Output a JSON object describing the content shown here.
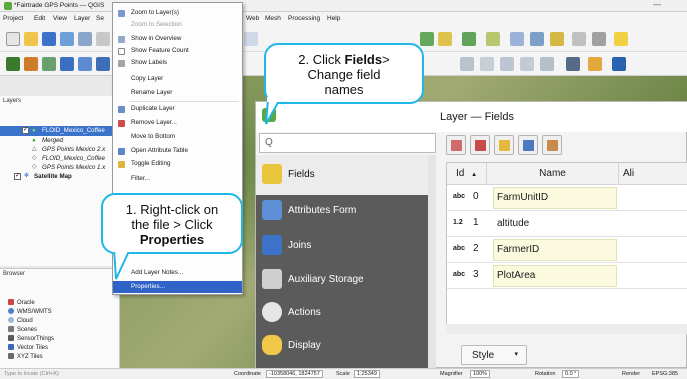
{
  "window": {
    "title": "*Fairtrade GPS Points — QGIS",
    "minimize_glyph": "—"
  },
  "menubar": {
    "items": [
      "Project",
      "Edit",
      "View",
      "Layer",
      "Se",
      "Web",
      "Mesh",
      "Processing",
      "Help"
    ]
  },
  "layers_panel": {
    "title": "Layers",
    "layers": [
      {
        "name": "FLOID_Mexico_Coffee",
        "checked": true,
        "selected": true
      },
      {
        "name": "Merged",
        "checked": true,
        "selected": false
      },
      {
        "name": "GPS Points Mexico 2.x",
        "checked": false,
        "selected": false
      },
      {
        "name": "FLOID_Mexico_Coffee",
        "checked": false,
        "selected": false
      },
      {
        "name": "GPS Points Mexico 1.x",
        "checked": false,
        "selected": false
      },
      {
        "name": "Satellite Map",
        "checked": true,
        "selected": false
      }
    ]
  },
  "browser_panel": {
    "title": "Browser",
    "items": [
      "Oracle",
      "WMS/WMTS",
      "Cloud",
      "Scenes",
      "SensorThings",
      "Vector Tiles",
      "XYZ Tiles"
    ]
  },
  "context_menu": {
    "items": [
      {
        "label": "Zoom to Layer(s)",
        "disabled": false
      },
      {
        "label": "Zoom to Selection",
        "disabled": true
      },
      {
        "label": "Show in Overview",
        "disabled": false
      },
      {
        "label": "Show Feature Count",
        "disabled": false
      },
      {
        "label": "Show Labels",
        "disabled": false
      },
      {
        "label": "Copy Layer",
        "disabled": false
      },
      {
        "label": "Rename Layer",
        "disabled": false
      },
      {
        "label": "Duplicate Layer",
        "disabled": false
      },
      {
        "label": "Remove Layer...",
        "disabled": false
      },
      {
        "label": "Move to Bottom",
        "disabled": false
      },
      {
        "label": "Open Attribute Table",
        "disabled": false
      },
      {
        "label": "Toggle Editing",
        "disabled": false
      },
      {
        "label": "Filter...",
        "disabled": false
      },
      {
        "label": "Add Layer Notes...",
        "disabled": false
      },
      {
        "label": "Properties...",
        "disabled": false,
        "selected": true
      }
    ]
  },
  "dialog": {
    "title": "Layer — Fields",
    "search_placeholder": "",
    "search_glyph": "Q",
    "sidebar": [
      {
        "label": "Fields",
        "icon": "fields-icon",
        "color": "#e8c53a",
        "selected": true
      },
      {
        "label": "Attributes Form",
        "icon": "form-icon",
        "color": "#5d8fd6",
        "selected": false
      },
      {
        "label": "Joins",
        "icon": "joins-icon",
        "color": "#3c73c9",
        "selected": false
      },
      {
        "label": "Auxiliary Storage",
        "icon": "database-icon",
        "color": "#cfcfcf",
        "selected": false
      },
      {
        "label": "Actions",
        "icon": "gear-icon",
        "color": "#e6e6e6",
        "selected": false
      },
      {
        "label": "Display",
        "icon": "speech-bubble-icon",
        "color": "#f2c84a",
        "selected": false
      }
    ],
    "grid": {
      "headers": [
        "Id",
        "Name",
        "Ali"
      ],
      "sort_glyph": "▲",
      "rows": [
        {
          "type": "abc",
          "id": "0",
          "name": "FarmUnitID"
        },
        {
          "type": "1.2",
          "id": "1",
          "name": "altitude"
        },
        {
          "type": "abc",
          "id": "2",
          "name": "FarmerID"
        },
        {
          "type": "abc",
          "id": "3",
          "name": "PlotArea"
        }
      ]
    },
    "style_button": {
      "label": "Style",
      "arrow": "▾"
    }
  },
  "callouts": {
    "step1": {
      "line1": "1. Right-click on",
      "line2": "the file > Click",
      "bold": "Properties"
    },
    "step2": {
      "prefix": "2. Click ",
      "bold": "Fields",
      "suffix": ">",
      "line2": "Change field",
      "line3": "names"
    }
  },
  "statusbar": {
    "locate_placeholder": "Type to locate (Ctrl+K)",
    "coordinate_label": "Coordinate",
    "coordinate_value": "-10358046, 1824757",
    "scale_label": "Scale",
    "scale_value": "1:25349",
    "magnifier_label": "Magnifier",
    "magnifier_value": "100%",
    "rotation_label": "Rotation",
    "rotation_value": "0.0 °",
    "render_label": "Render",
    "crs": "EPSG:385"
  },
  "colors": {
    "accent": "#1fb7e6",
    "selection": "#2f63c8",
    "sidebar": "#5b5b5b"
  }
}
